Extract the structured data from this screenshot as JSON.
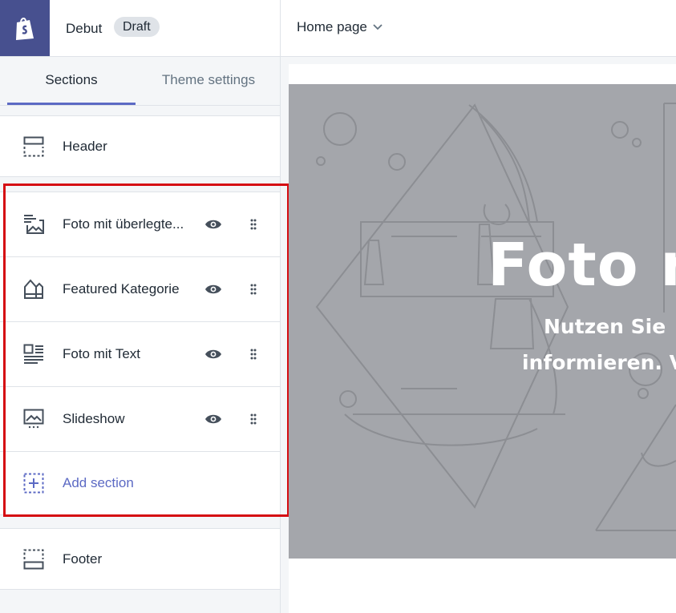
{
  "header": {
    "theme_name": "Debut",
    "status_badge": "Draft",
    "page_selector": "Home page"
  },
  "tabs": [
    {
      "label": "Sections",
      "active": true
    },
    {
      "label": "Theme settings",
      "active": false
    }
  ],
  "sections": {
    "header": {
      "label": "Header",
      "icon": "header-layout-icon"
    },
    "items": [
      {
        "label": "Foto mit überlegte...",
        "icon": "image-with-text-overlay-icon"
      },
      {
        "label": "Featured Kategorie",
        "icon": "collection-icon"
      },
      {
        "label": "Foto mit Text",
        "icon": "image-with-text-icon"
      },
      {
        "label": "Slideshow",
        "icon": "slideshow-icon"
      }
    ],
    "add_section": {
      "label": "Add section",
      "icon": "add-section-icon"
    },
    "footer": {
      "label": "Footer",
      "icon": "footer-layout-icon"
    }
  },
  "preview": {
    "hero_title": "Foto m",
    "hero_line1": "Nutzen Sie",
    "hero_line2": "informieren. V"
  },
  "colors": {
    "brand_logo_bg": "#47508f",
    "accent": "#5c6ac4",
    "highlight_box": "#d50c12",
    "hero_placeholder": "#a4a6ab"
  }
}
